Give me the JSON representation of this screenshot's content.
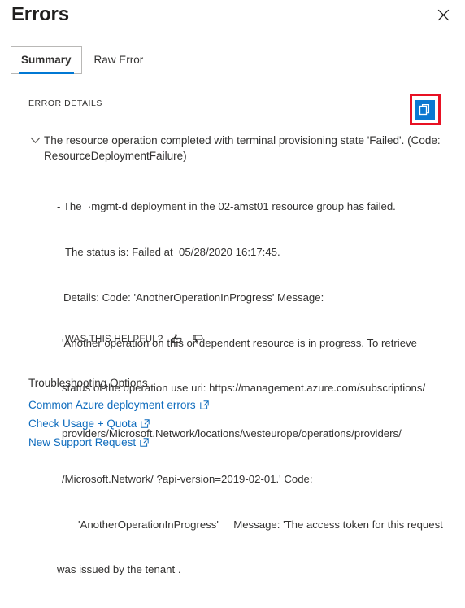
{
  "header": {
    "title": "Errors",
    "close_icon": "close-icon",
    "close_label": "Close"
  },
  "tabs": [
    {
      "id": "summary",
      "label": "Summary",
      "selected": true
    },
    {
      "id": "raw-error",
      "label": "Raw Error",
      "selected": false
    }
  ],
  "error_details": {
    "section_label": "ERROR DETAILS",
    "copy_button": {
      "icon": "copy-icon",
      "tooltip": "Copy",
      "icon_color": "#0b78d1",
      "highlight_color": "#e81123"
    },
    "entry": {
      "expander_icon": "chevron-down-icon",
      "expanded": true,
      "summary": "The resource operation completed with terminal provisioning state 'Failed'. (Code: ResourceDeploymentFailure)",
      "detail_lines": [
        "- The  ·mgmt-d deployment in the 02-amst01 resource group has failed.",
        "The status is: Failed at  05/28/2020 16:17:45.",
        "Details: Code: 'AnotherOperationInProgress' Message:",
        "'Another operation on this or dependent resource is in progress. To retrieve",
        "status of the operation use uri: https://management.azure.com/subscriptions/",
        "providers/Microsoft.Network/locations/westeurope/operations/providers/",
        "/Microsoft.Network/ ?api-version=2019-02-01.' Code:",
        "'AnotherOperationInProgress'     Message: 'The access token for this request",
        "was issued by the tenant ."
      ]
    }
  },
  "feedback": {
    "label": "WAS THIS HELPFUL?",
    "thumbs_up_icon": "thumbs-up-icon",
    "thumbs_down_icon": "thumbs-down-icon"
  },
  "troubleshooting": {
    "title": "Troubleshooting Options",
    "link_color": "#0f6cbd",
    "links": [
      {
        "label": "Common Azure deployment errors",
        "icon": "external-link-icon"
      },
      {
        "label": "Check Usage + Quota",
        "icon": "external-link-icon"
      },
      {
        "label": "New Support Request",
        "icon": "external-link-icon"
      }
    ]
  }
}
